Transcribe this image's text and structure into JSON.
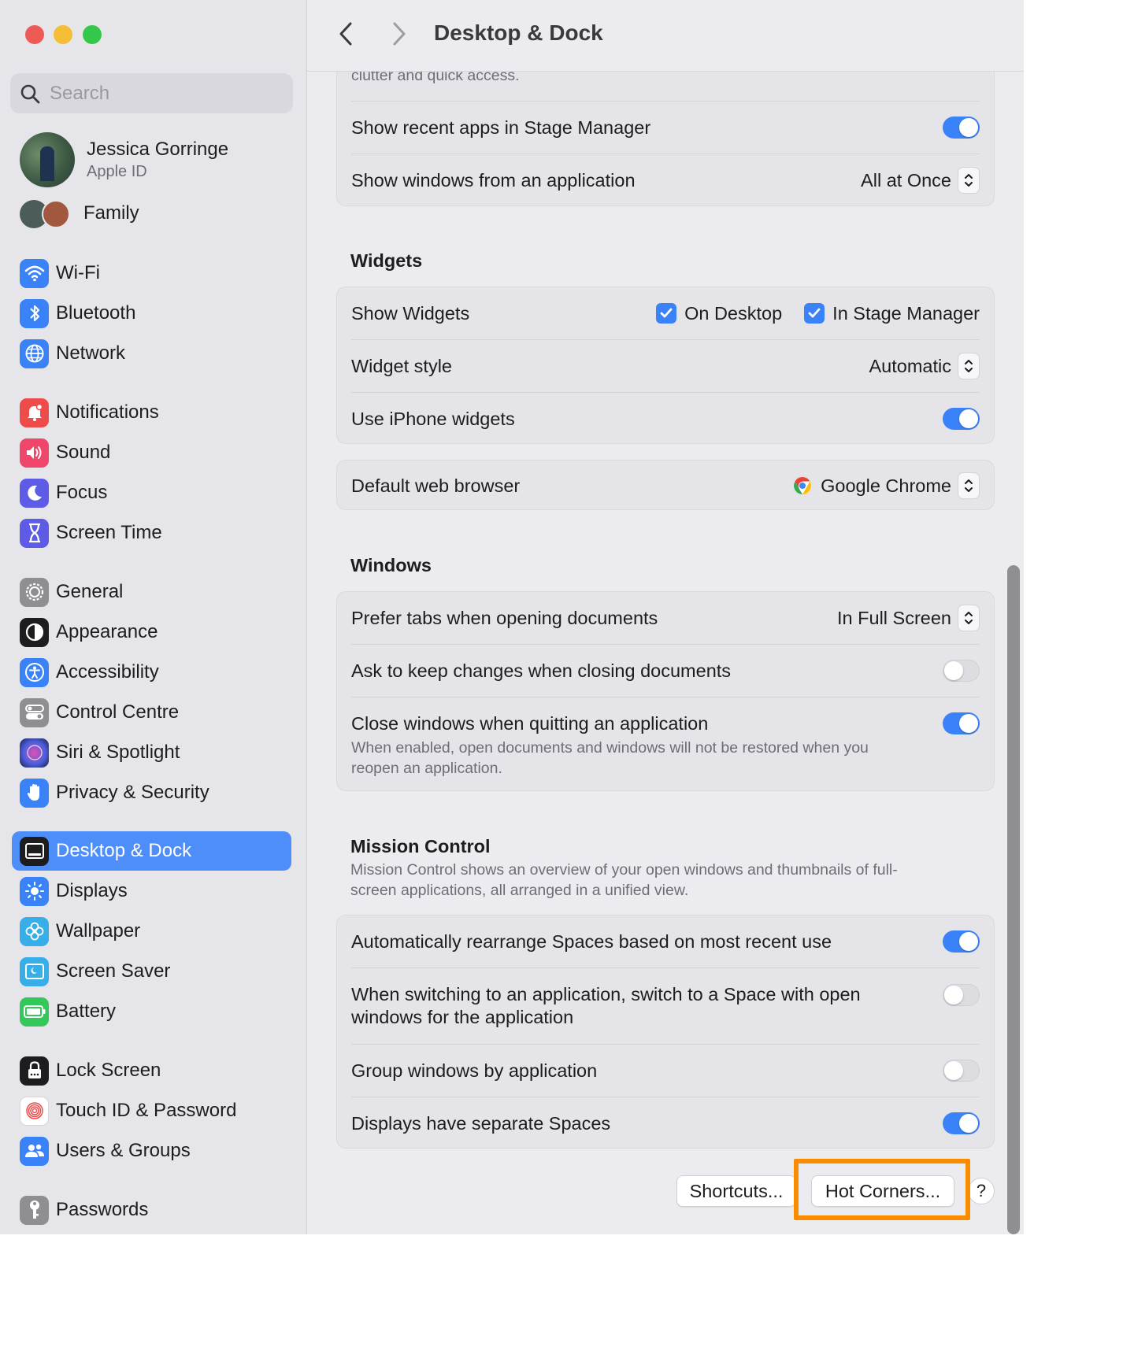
{
  "window": {
    "title": "Desktop & Dock"
  },
  "sidebar": {
    "search_placeholder": "Search",
    "profile": {
      "name": "Jessica Gorringe",
      "subtitle": "Apple ID"
    },
    "family_label": "Family",
    "items": [
      {
        "label": "Wi-Fi",
        "icon": "wifi-icon",
        "color": "#3a82f7"
      },
      {
        "label": "Bluetooth",
        "icon": "bluetooth-icon",
        "color": "#3a82f7"
      },
      {
        "label": "Network",
        "icon": "globe-icon",
        "color": "#3a82f7"
      },
      {
        "label": "Notifications",
        "icon": "bell-icon",
        "color": "#f04b4b"
      },
      {
        "label": "Sound",
        "icon": "speaker-icon",
        "color": "#f0466c"
      },
      {
        "label": "Focus",
        "icon": "moon-icon",
        "color": "#5e5ce6"
      },
      {
        "label": "Screen Time",
        "icon": "hourglass-icon",
        "color": "#5e5ce6"
      },
      {
        "label": "General",
        "icon": "gear-icon",
        "color": "#8e8e93"
      },
      {
        "label": "Appearance",
        "icon": "appearance-icon",
        "color": "#1d1d1f"
      },
      {
        "label": "Accessibility",
        "icon": "accessibility-icon",
        "color": "#3a82f7"
      },
      {
        "label": "Control Centre",
        "icon": "control-centre-icon",
        "color": "#8e8e93"
      },
      {
        "label": "Siri & Spotlight",
        "icon": "siri-icon",
        "color": "#6b3bd6"
      },
      {
        "label": "Privacy & Security",
        "icon": "hand-icon",
        "color": "#3a82f7"
      },
      {
        "label": "Desktop & Dock",
        "icon": "dock-icon",
        "color": "#1d1d1f",
        "active": true
      },
      {
        "label": "Displays",
        "icon": "sun-icon",
        "color": "#3a82f7"
      },
      {
        "label": "Wallpaper",
        "icon": "flower-icon",
        "color": "#37aee8"
      },
      {
        "label": "Screen Saver",
        "icon": "screensaver-icon",
        "color": "#37aee8"
      },
      {
        "label": "Battery",
        "icon": "battery-icon",
        "color": "#34c759"
      },
      {
        "label": "Lock Screen",
        "icon": "lock-icon",
        "color": "#1d1d1f"
      },
      {
        "label": "Touch ID & Password",
        "icon": "fingerprint-icon",
        "color": "#f04b4b"
      },
      {
        "label": "Users & Groups",
        "icon": "users-icon",
        "color": "#3a82f7"
      },
      {
        "label": "Passwords",
        "icon": "key-icon",
        "color": "#8e8e93"
      }
    ]
  },
  "stage_manager": {
    "clipped_desc": "clutter and quick access.",
    "show_recent_apps": {
      "label": "Show recent apps in Stage Manager",
      "on": true
    },
    "show_windows": {
      "label": "Show windows from an application",
      "value": "All at Once"
    }
  },
  "widgets": {
    "header": "Widgets",
    "show_widgets": {
      "label": "Show Widgets",
      "on_desktop": "On Desktop",
      "in_stage_manager": "In Stage Manager"
    },
    "widget_style": {
      "label": "Widget style",
      "value": "Automatic"
    },
    "iphone_widgets": {
      "label": "Use iPhone widgets",
      "on": true
    },
    "default_browser": {
      "label": "Default web browser",
      "value": "Google Chrome"
    }
  },
  "windows": {
    "header": "Windows",
    "prefer_tabs": {
      "label": "Prefer tabs when opening documents",
      "value": "In Full Screen"
    },
    "ask_keep_changes": {
      "label": "Ask to keep changes when closing documents",
      "on": false
    },
    "close_windows": {
      "label": "Close windows when quitting an application",
      "desc_line1": "When enabled, open documents and windows will not be restored when you",
      "desc_line2": "reopen an application.",
      "on": true
    }
  },
  "mission_control": {
    "header": "Mission Control",
    "desc_line1": "Mission Control shows an overview of your open windows and thumbnails of full-",
    "desc_line2": "screen applications, all arranged in a unified view.",
    "auto_rearrange": {
      "label": "Automatically rearrange Spaces based on most recent use",
      "on": true
    },
    "switch_space": {
      "label_line1": "When switching to an application, switch to a Space with open",
      "label_line2": "windows for the application",
      "on": false
    },
    "group_windows": {
      "label": "Group windows by application",
      "on": false
    },
    "separate_spaces": {
      "label": "Displays have separate Spaces",
      "on": true
    }
  },
  "footer": {
    "shortcuts_label": "Shortcuts...",
    "hot_corners_label": "Hot Corners...",
    "help_label": "?"
  },
  "annotation": {
    "highlight_color": "#fb8c00"
  }
}
